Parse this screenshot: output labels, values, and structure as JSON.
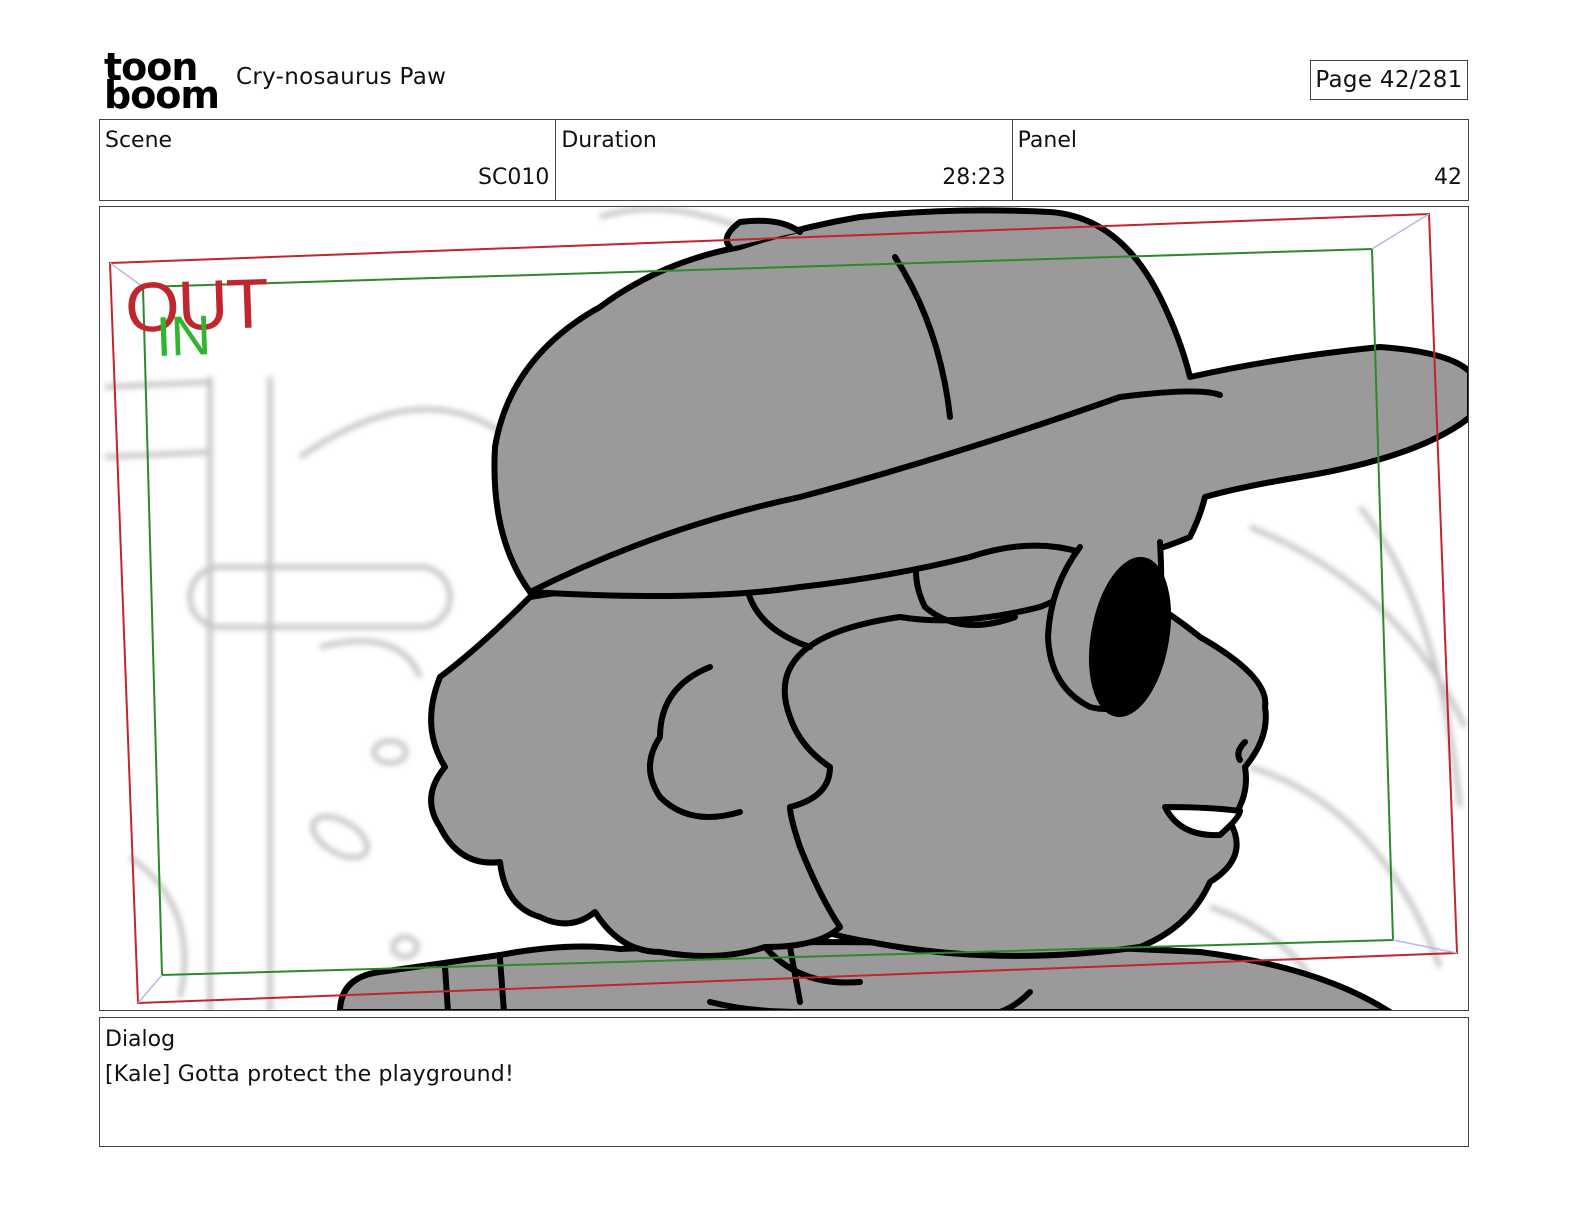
{
  "header": {
    "logo_top": "toon",
    "logo_bottom": "boom",
    "project_title": "Cry-nosaurus Paw",
    "page_label": "Page  42/281"
  },
  "info": {
    "scene_label": "Scene",
    "scene_value": "SC010",
    "duration_label": "Duration",
    "duration_value": "28:23",
    "panel_label": "Panel",
    "panel_value": "42"
  },
  "panel": {
    "out_label": "OUT",
    "in_label": "IN",
    "colors": {
      "out_frame": "#c0262c",
      "in_frame": "#2b8a2b",
      "fill": "#9a9a9a",
      "line": "#000000"
    }
  },
  "dialog": {
    "label": "Dialog",
    "text": "[Kale] Gotta protect the playground!"
  }
}
